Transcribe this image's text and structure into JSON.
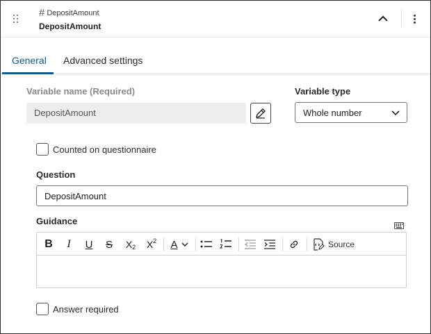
{
  "header": {
    "type_symbol": "#",
    "type_label": "DepositAmount",
    "variable_title": "DepositAmount",
    "icons": {
      "drag": "drag-handle-icon",
      "collapse": "chevron-up-icon",
      "more": "more-vertical-icon"
    }
  },
  "tabs": [
    {
      "label": "General",
      "active": true
    },
    {
      "label": "Advanced settings",
      "active": false
    }
  ],
  "form": {
    "variable_name_label": "Variable name (Required)",
    "variable_name_value": "DepositAmount",
    "variable_type_label": "Variable type",
    "variable_type_value": "Whole number",
    "counted_label": "Counted on questionnaire",
    "counted_checked": false,
    "question_label": "Question",
    "question_value": "DepositAmount",
    "guidance_label": "Guidance",
    "answer_required_label": "Answer required",
    "answer_required_checked": false
  },
  "toolbar": {
    "bold": "B",
    "italic": "I",
    "underline": "U",
    "strike": "S",
    "subscript_base": "X",
    "subscript_mark": "2",
    "superscript_base": "X",
    "superscript_mark": "2",
    "font_color": "A",
    "source_label": "Source"
  },
  "colors": {
    "accent": "#0e5a8a",
    "border": "#767676",
    "disabled_bg": "#ededed"
  }
}
